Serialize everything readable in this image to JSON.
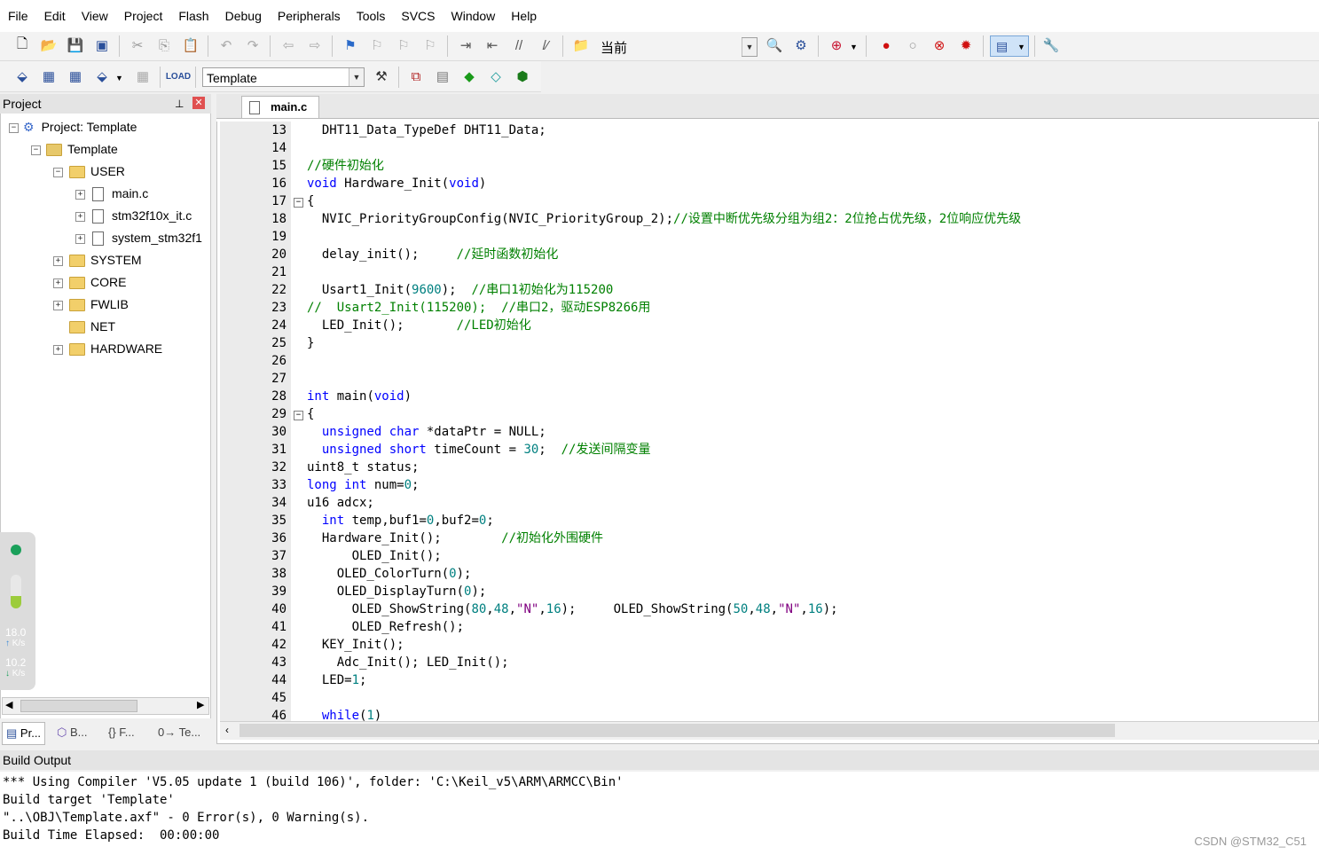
{
  "menu": [
    "File",
    "Edit",
    "View",
    "Project",
    "Flash",
    "Debug",
    "Peripherals",
    "Tools",
    "SVCS",
    "Window",
    "Help"
  ],
  "toolbar1": {
    "target_label": "当前"
  },
  "toolbar2": {
    "target_select": "Template"
  },
  "project": {
    "pane_title": "Project",
    "root": "Project: Template",
    "target": "Template",
    "groups": {
      "user": "USER",
      "files": [
        "main.c",
        "stm32f10x_it.c",
        "system_stm32f1"
      ],
      "system": "SYSTEM",
      "core": "CORE",
      "fwlib": "FWLIB",
      "net": "NET",
      "hardware": "HARDWARE"
    },
    "tabs": [
      "Pr...",
      "B...",
      "{} F...",
      "0→ Te..."
    ]
  },
  "widget": {
    "up_value": "18.0",
    "up_unit": "K/s",
    "down_value": "10.2",
    "down_unit": "K/s"
  },
  "editor": {
    "tab": "main.c",
    "line_numbers": [
      "13",
      "14",
      "15",
      "16",
      "17",
      "18",
      "19",
      "20",
      "21",
      "22",
      "23",
      "24",
      "25",
      "26",
      "27",
      "28",
      "29",
      "30",
      "31",
      "32",
      "33",
      "34",
      "35",
      "36",
      "37",
      "38",
      "39",
      "40",
      "41",
      "42",
      "43",
      "44",
      "45",
      "46"
    ]
  },
  "code": {
    "l13": "  DHT11_Data_TypeDef DHT11_Data;",
    "l15": "//硬件初始化",
    "l16a": "void",
    "l16b": " Hardware_Init(",
    "l16c": "void",
    "l16d": ")",
    "l17": "{",
    "l18a": "  NVIC_PriorityGroupConfig(NVIC_PriorityGroup_2);",
    "l18b": "//设置中断优先级分组为组2：2位抢占优先级，2位响应优先级",
    "l20a": "  delay_init();     ",
    "l20b": "//延时函数初始化",
    "l22a": "  Usart1_Init(",
    "l22b": "9600",
    "l22c": ");  ",
    "l22d": "//串口1初始化为115200",
    "l23": "//  Usart2_Init(115200);  //串口2，驱动ESP8266用",
    "l24a": "  LED_Init();       ",
    "l24b": "//LED初始化",
    "l25": "}",
    "l28a": "int",
    "l28b": " main(",
    "l28c": "void",
    "l28d": ")",
    "l29": "{",
    "l30a": "  unsigned char",
    "l30b": " *dataPtr = NULL;",
    "l31a": "  unsigned short",
    "l31b": " timeCount = ",
    "l31c": "30",
    "l31d": ";  ",
    "l31e": "//发送间隔变量",
    "l32": "uint8_t status;",
    "l33a": "long int",
    "l33b": " num=",
    "l33c": "0",
    "l33d": ";",
    "l34": "u16 adcx;",
    "l35a": "  int",
    "l35b": " temp,buf1=",
    "l35c": "0",
    "l35d": ",buf2=",
    "l35e": "0",
    "l35f": ";",
    "l36a": "  Hardware_Init();        ",
    "l36b": "//初始化外围硬件",
    "l37": "      OLED_Init();",
    "l38a": "    OLED_ColorTurn(",
    "l38b": "0",
    "l38c": ");",
    "l39a": "    OLED_DisplayTurn(",
    "l39b": "0",
    "l39c": ");",
    "l40a": "      OLED_ShowString(",
    "l40b": "80",
    "l40c": ",",
    "l40d": "48",
    "l40e": ",",
    "l40f": "\"N\"",
    "l40g": ",",
    "l40h": "16",
    "l40i": ");     OLED_ShowString(",
    "l40j": "50",
    "l40k": ",",
    "l40l": "48",
    "l40m": ",",
    "l40n": "\"N\"",
    "l40o": ",",
    "l40p": "16",
    "l40q": ");",
    "l41": "      OLED_Refresh();",
    "l42": "  KEY_Init();",
    "l43": "    Adc_Init(); LED_Init();",
    "l44a": "  LED=",
    "l44b": "1",
    "l44c": ";",
    "l46a": "  while",
    "l46b": "(",
    "l46c": "1",
    "l46d": ")"
  },
  "build": {
    "title": "Build Output",
    "lines": [
      "*** Using Compiler 'V5.05 update 1 (build 106)', folder: 'C:\\Keil_v5\\ARM\\ARMCC\\Bin'",
      "Build target 'Template'",
      "\"..\\OBJ\\Template.axf\" - 0 Error(s), 0 Warning(s).",
      "Build Time Elapsed:  00:00:00"
    ]
  },
  "watermark": "CSDN @STM32_C51"
}
